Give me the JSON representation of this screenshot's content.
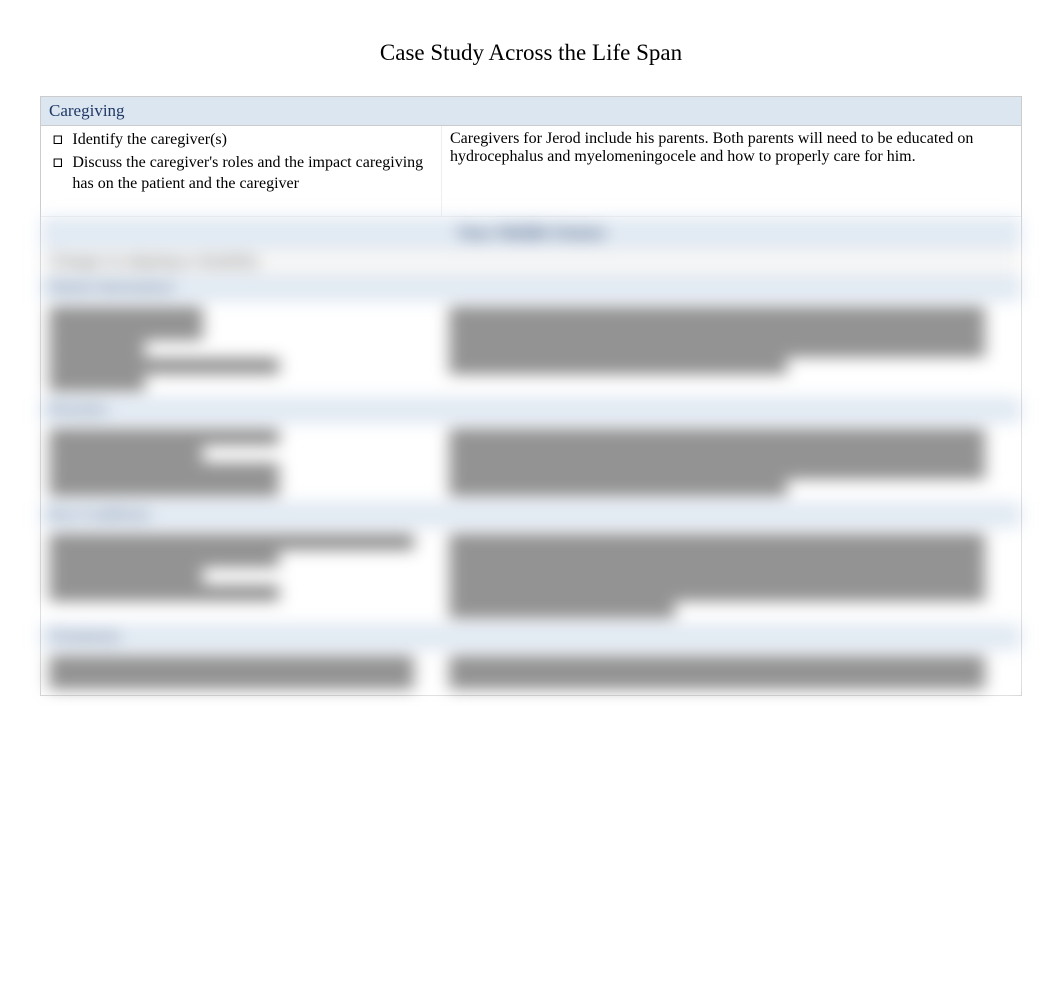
{
  "title": "Case Study Across the Life Span",
  "caregiving": {
    "header": "Caregiving",
    "bullets": [
      "Identify the caregiver(s)",
      "Discuss the caregiver's roles and the impact caregiving has on the patient and the caregiver"
    ],
    "content": "Caregivers for Jerod include his parents. Both parents will need to be educated on hydrocephalus and myelomeningocele and how to properly care for him."
  },
  "blurred": {
    "main_header": "Your Middle Patient",
    "sub_header": "Changes in adapting to disability",
    "sections": [
      {
        "title": "Patient Information",
        "left_lines": [
          "short",
          "short",
          "xshort",
          "med",
          "xshort"
        ],
        "right_lines": [
          "long",
          "long",
          "long",
          "med"
        ]
      },
      {
        "title": "Priorities",
        "left_lines": [
          "med",
          "short",
          "med",
          "med"
        ],
        "right_lines": [
          "long",
          "long",
          "long",
          "med"
        ]
      },
      {
        "title": "Key Conditions",
        "left_lines": [
          "long",
          "med",
          "short",
          "med"
        ],
        "right_lines": [
          "long",
          "long",
          "long",
          "long",
          "short"
        ]
      },
      {
        "title": "Treatments",
        "left_lines": [
          "long",
          "long"
        ],
        "right_lines": [
          "long",
          "long"
        ]
      }
    ]
  }
}
